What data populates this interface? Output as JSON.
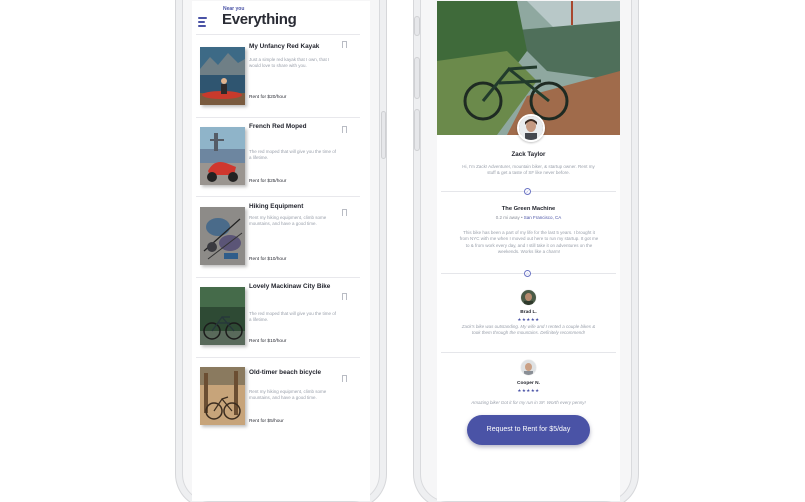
{
  "list_screen": {
    "subtitle": "Near you",
    "title": "Everything",
    "items": [
      {
        "name": "My Unfancy Red Kayak",
        "description": "Just a simple red kayak that I own, that I would love to share with you.",
        "price": "Rent for $20/hour"
      },
      {
        "name": "French Red Moped",
        "description": "The red moped that will give you the time of a lifetime.",
        "price": "Rent for $25/hour"
      },
      {
        "name": "Hiking Equipment",
        "description": "Rent my hiking equipment, climb some mountains, and have a good time.",
        "price": "Rent for $10/hour"
      },
      {
        "name": "Lovely Mackinaw City Bike",
        "description": "The red moped that will give you the time of a lifetime.",
        "price": "Rent for $10/hour"
      },
      {
        "name": "Old-timer beach bicycle",
        "description": "Rent my hiking equipment, climb some mountains, and have a good time.",
        "price": "Rent for $5/hour"
      }
    ]
  },
  "detail_screen": {
    "owner": {
      "name": "Zack Taylor",
      "bio": "Hi, I'm Zack! Adventurer, mountain biker, & startup owner. Rent my stuff & get a taste of SF like never before."
    },
    "item": {
      "title": "The Green Machine",
      "distance": "0.2 mi away •",
      "city": "San Francisco, CA",
      "story": "This bike has been a part of my life for the last 5 years. I brought it from NYC with me when I moved out here to run my startup. It got me to & from work every day, and I still take it on adventures on the weekends. Works like a charm!"
    },
    "reviews": [
      {
        "name": "Brad L.",
        "stars": "★★★★★",
        "text": "Zack's bike was outstanding. My wife and I rented a couple bikes & took them through the mountains. Definitely recommend!"
      },
      {
        "name": "Cooper N.",
        "stars": "★★★★★",
        "text": "Amazing bike! Got it for my run in SF. Worth every penny!"
      }
    ],
    "cta_label": "Request to Rent for $5/day"
  },
  "colors": {
    "accent": "#4a53a6"
  }
}
